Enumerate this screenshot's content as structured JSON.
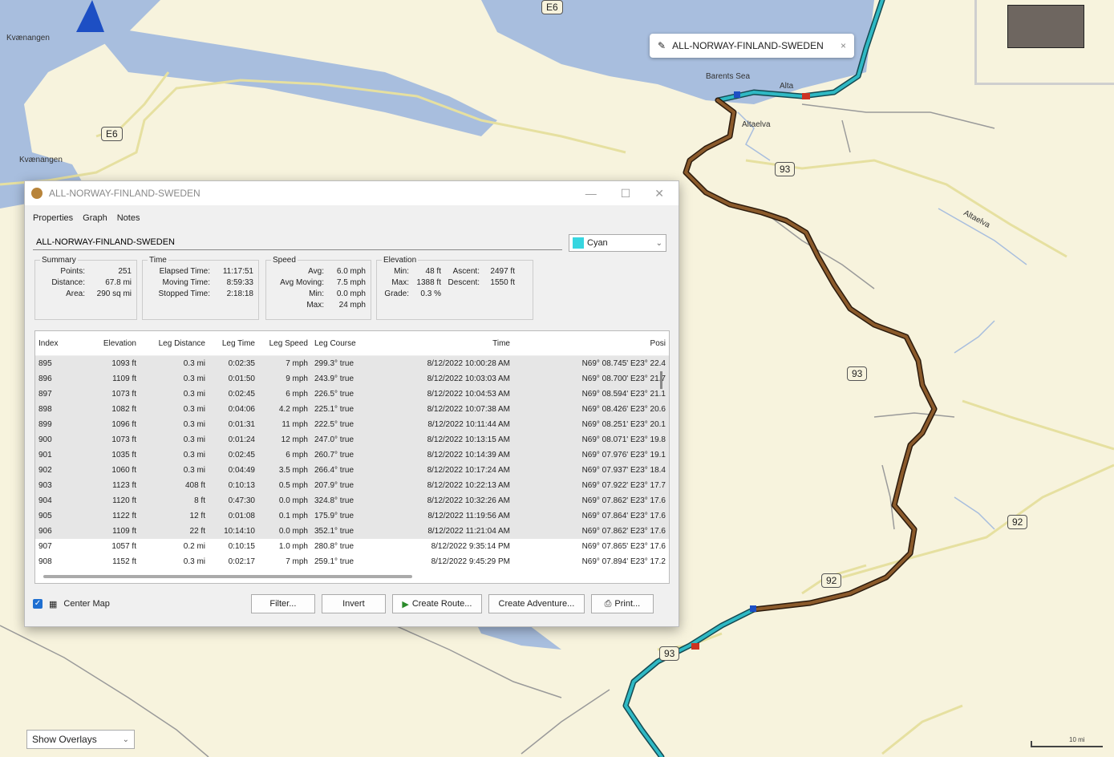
{
  "map": {
    "road_labels": [
      "E6",
      "E6",
      "93",
      "93",
      "92",
      "92",
      "93"
    ],
    "place_labels": [
      "Kvænangen",
      "Kvænangen",
      "Barents Sea",
      "Alta",
      "Altaelva",
      "Altaelva"
    ],
    "track_pill": {
      "icon": "track-icon",
      "label": "ALL-NORWAY-FINLAND-SWEDEN",
      "close": "×"
    },
    "overlays_select": {
      "label": "Show Overlays",
      "chevron": "⌄"
    },
    "scale_label": "10 mi",
    "colors": {
      "water": "#a8bede",
      "land": "#f7f3dd",
      "road": "#e6e0a0",
      "track": "#8b5a2b",
      "track_cyan": "#2fb9c4"
    }
  },
  "window": {
    "title": "ALL-NORWAY-FINLAND-SWEDEN",
    "icon": "globe-icon",
    "controls": {
      "minimize": "—",
      "maximize": "☐",
      "close": "✕"
    },
    "tabs": [
      "Properties",
      "Graph",
      "Notes"
    ],
    "name_value": "ALL-NORWAY-FINLAND-SWEDEN",
    "color": {
      "label": "Cyan",
      "hex": "#37d6e0",
      "chevron": "⌄"
    },
    "summary": {
      "legend": "Summary",
      "rows": [
        [
          "Points:",
          "251"
        ],
        [
          "Distance:",
          "67.8 mi"
        ],
        [
          "Area:",
          "290 sq mi"
        ]
      ]
    },
    "time": {
      "legend": "Time",
      "rows": [
        [
          "Elapsed Time:",
          "11:17:51"
        ],
        [
          "Moving Time:",
          "8:59:33"
        ],
        [
          "Stopped Time:",
          "2:18:18"
        ]
      ]
    },
    "speed": {
      "legend": "Speed",
      "rows": [
        [
          "Avg:",
          "6.0 mph"
        ],
        [
          "Avg Moving:",
          "7.5 mph"
        ],
        [
          "Min:",
          "0.0 mph"
        ],
        [
          "Max:",
          "24 mph"
        ]
      ]
    },
    "elevation": {
      "legend": "Elevation",
      "rows": [
        [
          "Min:",
          "48 ft",
          "Ascent:",
          "2497 ft"
        ],
        [
          "Max:",
          "1388 ft",
          "Descent:",
          "1550 ft"
        ],
        [
          "Grade:",
          "0.3 %",
          "",
          ""
        ]
      ]
    },
    "table": {
      "headers": [
        "Index",
        "Elevation",
        "Leg Distance",
        "Leg Time",
        "Leg Speed",
        "Leg Course",
        "Time",
        "Posi"
      ],
      "rows": [
        [
          "895",
          "1093 ft",
          "0.3 mi",
          "0:02:35",
          "7 mph",
          "299.3° true",
          "8/12/2022 10:00:28 AM",
          "N69° 08.745' E23° 22.4"
        ],
        [
          "896",
          "1109 ft",
          "0.3 mi",
          "0:01:50",
          "9 mph",
          "243.9° true",
          "8/12/2022 10:03:03 AM",
          "N69° 08.700' E23° 21.7"
        ],
        [
          "897",
          "1073 ft",
          "0.3 mi",
          "0:02:45",
          "6 mph",
          "226.5° true",
          "8/12/2022 10:04:53 AM",
          "N69° 08.594' E23° 21.1"
        ],
        [
          "898",
          "1082 ft",
          "0.3 mi",
          "0:04:06",
          "4.2 mph",
          "225.1° true",
          "8/12/2022 10:07:38 AM",
          "N69° 08.426' E23° 20.6"
        ],
        [
          "899",
          "1096 ft",
          "0.3 mi",
          "0:01:31",
          "11 mph",
          "222.5° true",
          "8/12/2022 10:11:44 AM",
          "N69° 08.251' E23° 20.1"
        ],
        [
          "900",
          "1073 ft",
          "0.3 mi",
          "0:01:24",
          "12 mph",
          "247.0° true",
          "8/12/2022 10:13:15 AM",
          "N69° 08.071' E23° 19.8"
        ],
        [
          "901",
          "1035 ft",
          "0.3 mi",
          "0:02:45",
          "6 mph",
          "260.7° true",
          "8/12/2022 10:14:39 AM",
          "N69° 07.976' E23° 19.1"
        ],
        [
          "902",
          "1060 ft",
          "0.3 mi",
          "0:04:49",
          "3.5 mph",
          "266.4° true",
          "8/12/2022 10:17:24 AM",
          "N69° 07.937' E23° 18.4"
        ],
        [
          "903",
          "1123 ft",
          "408 ft",
          "0:10:13",
          "0.5 mph",
          "207.9° true",
          "8/12/2022 10:22:13 AM",
          "N69° 07.922' E23° 17.7"
        ],
        [
          "904",
          "1120 ft",
          "8 ft",
          "0:47:30",
          "0.0 mph",
          "324.8° true",
          "8/12/2022 10:32:26 AM",
          "N69° 07.862' E23° 17.6"
        ],
        [
          "905",
          "1122 ft",
          "12 ft",
          "0:01:08",
          "0.1 mph",
          "175.9° true",
          "8/12/2022 11:19:56 AM",
          "N69° 07.864' E23° 17.6"
        ],
        [
          "906",
          "1109 ft",
          "22 ft",
          "10:14:10",
          "0.0 mph",
          "352.1° true",
          "8/12/2022 11:21:04 AM",
          "N69° 07.862' E23° 17.6"
        ],
        [
          "907",
          "1057 ft",
          "0.2 mi",
          "0:10:15",
          "1.0 mph",
          "280.8° true",
          "8/12/2022 9:35:14 PM",
          "N69° 07.865' E23° 17.6"
        ],
        [
          "908",
          "1152 ft",
          "0.3 mi",
          "0:02:17",
          "7 mph",
          "259.1° true",
          "8/12/2022 9:45:29 PM",
          "N69° 07.894' E23° 17.2"
        ]
      ]
    },
    "buttons": {
      "center_map": "Center Map",
      "filter": "Filter...",
      "invert": "Invert",
      "create_route": "Create Route...",
      "create_adventure": "Create Adventure...",
      "print": "Print..."
    }
  }
}
